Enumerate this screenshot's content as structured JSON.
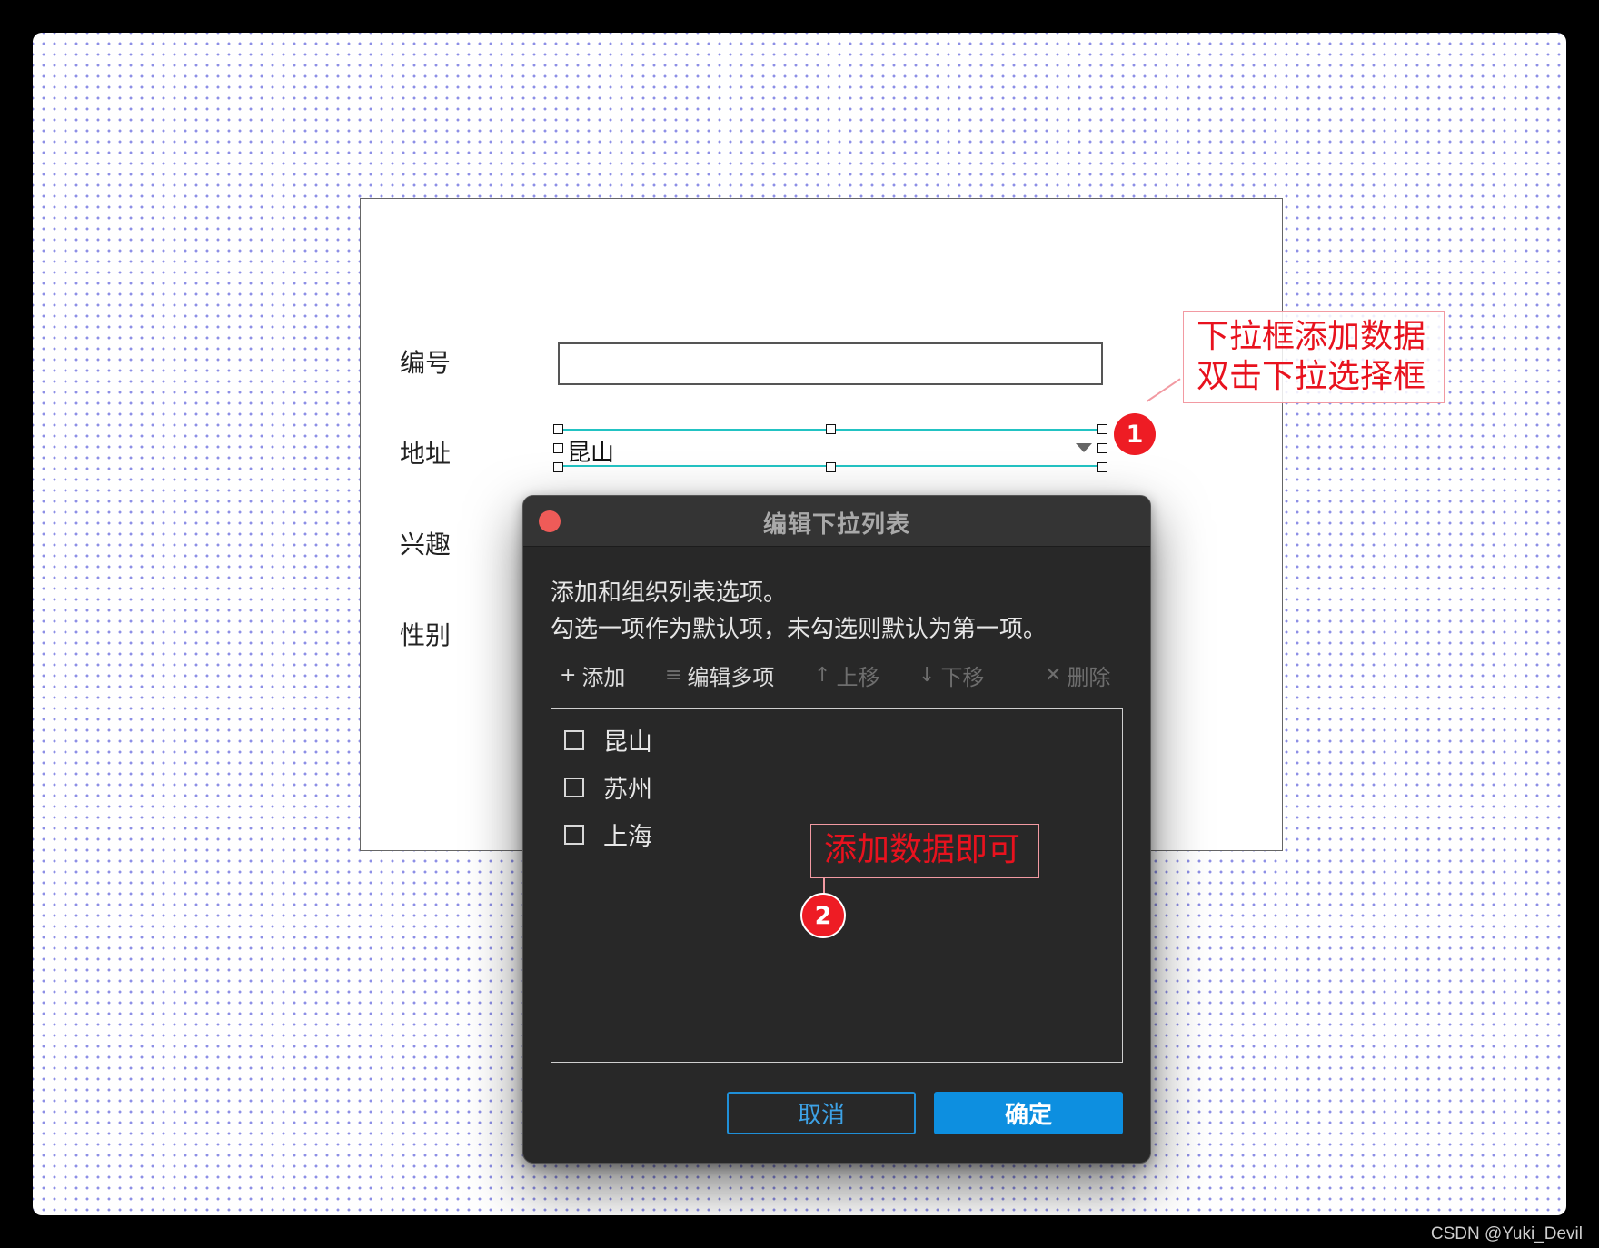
{
  "form": {
    "labels": [
      "编号",
      "地址",
      "兴趣",
      "性别"
    ],
    "address_value": "昆山"
  },
  "annotations": {
    "callout1_lines": [
      "下拉框添加数据",
      "双击下拉选择框"
    ],
    "badge1": "1",
    "callout2": "添加数据即可",
    "badge2": "2"
  },
  "dialog": {
    "title": "编辑下拉列表",
    "desc_line1": "添加和组织列表选项。",
    "desc_line2": "勾选一项作为默认项，未勾选则默认为第一项。",
    "toolbar": {
      "add": {
        "icon": "+",
        "label": "添加",
        "enabled": true
      },
      "edit_multi": {
        "icon": "≡",
        "label": "编辑多项",
        "enabled": true
      },
      "move_up": {
        "icon": "↑",
        "label": "上移",
        "enabled": false
      },
      "move_down": {
        "icon": "↓",
        "label": "下移",
        "enabled": false
      },
      "delete": {
        "icon": "✕",
        "label": "删除",
        "enabled": false
      }
    },
    "items": [
      {
        "label": "昆山",
        "checked": false
      },
      {
        "label": "苏州",
        "checked": false
      },
      {
        "label": "上海",
        "checked": false
      }
    ],
    "cancel_label": "取消",
    "ok_label": "确定"
  },
  "colors": {
    "annotation_red": "#e8121e",
    "selection_cyan": "#22c3c3",
    "primary_blue": "#0d8fe0",
    "close_red": "#ef5b58"
  },
  "watermark": "CSDN @Yuki_Devil"
}
